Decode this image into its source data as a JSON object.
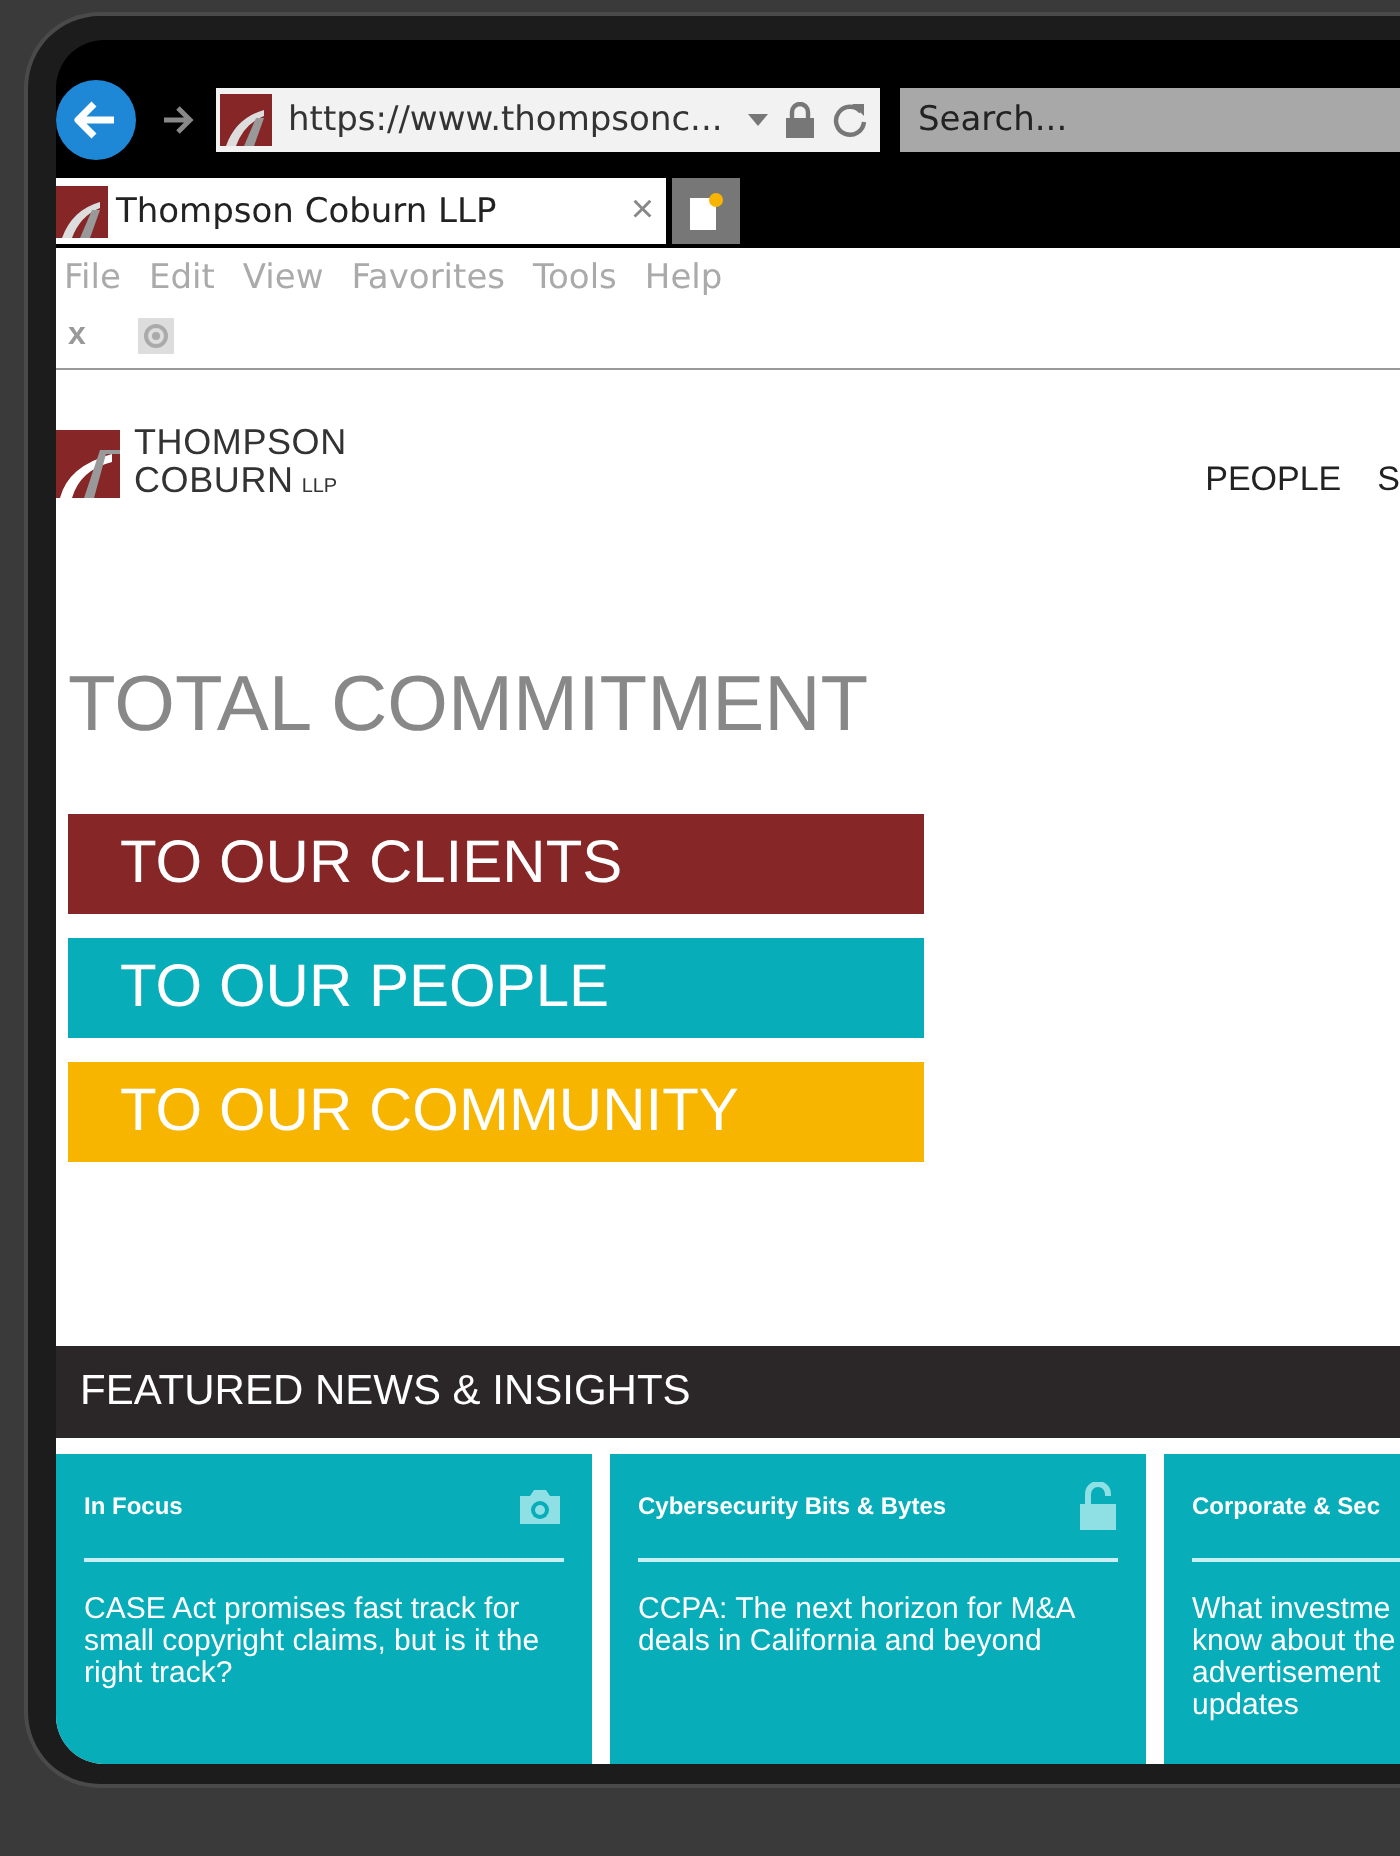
{
  "browser": {
    "url": "https://www.thompsonc...",
    "search_placeholder": "Search...",
    "tabs": [
      {
        "title": "Thompson Coburn LLP",
        "close": "×",
        "selected": true
      }
    ],
    "menu": [
      "File",
      "Edit",
      "View",
      "Favorites",
      "Tools",
      "Help"
    ],
    "toolbar_close": "x"
  },
  "site": {
    "logo_line1": "THOMPSON",
    "logo_line2": "COBURN",
    "logo_suffix": "LLP",
    "nav": [
      "PEOPLE",
      "S"
    ],
    "headline": "TOTAL COMMITMENT",
    "commitments": [
      {
        "label": "TO OUR CLIENTS",
        "color": "#862627"
      },
      {
        "label": "TO OUR PEOPLE",
        "color": "#07adb9"
      },
      {
        "label": "TO OUR COMMUNITY",
        "color": "#f7b500"
      }
    ],
    "featured_title": "FEATURED NEWS & INSIGHTS",
    "cards": [
      {
        "category": "In Focus",
        "kind": "camera",
        "lines": [
          "CASE Act promises fast track for",
          "small copyright claims, but is it the",
          "right track?"
        ]
      },
      {
        "category": "Cybersecurity Bits & Bytes",
        "kind": "lock",
        "lines": [
          "CCPA: The next horizon for M&A",
          "deals in California and beyond"
        ]
      },
      {
        "category": "Corporate & Sec",
        "kind": "plain",
        "lines": [
          "What investme",
          "know about the",
          "advertisement",
          "updates"
        ]
      }
    ]
  }
}
